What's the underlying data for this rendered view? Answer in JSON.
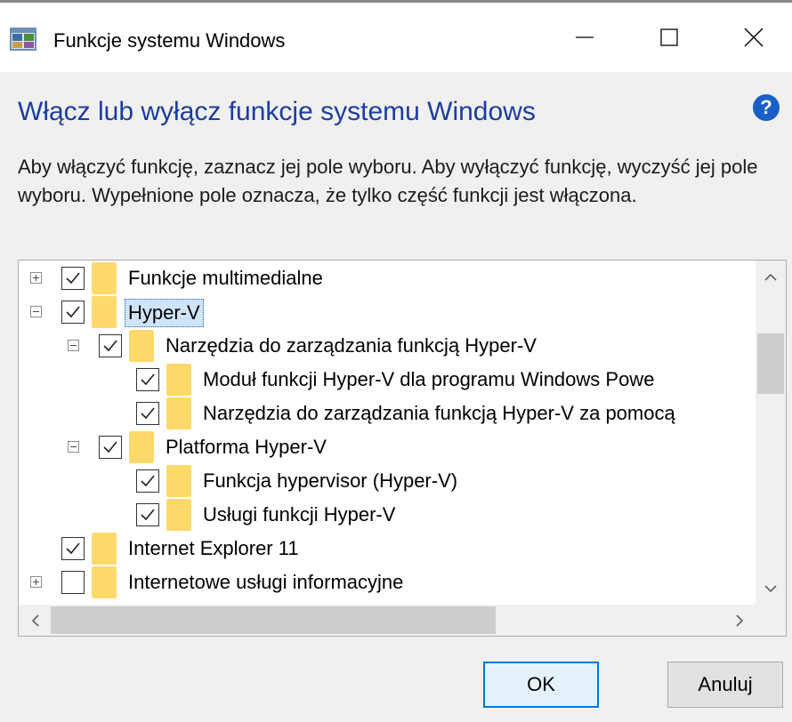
{
  "window": {
    "title": "Funkcje systemu Windows",
    "controls": {
      "minimize": "minimize",
      "maximize": "maximize",
      "close": "close"
    }
  },
  "header": {
    "title": "Włącz lub wyłącz funkcje systemu Windows",
    "help_symbol": "?"
  },
  "description": "Aby włączyć funkcję, zaznacz jej pole wyboru. Aby wyłączyć funkcję, wyczyść jej pole wyboru. Wypełnione pole oznacza, że tylko część funkcji jest włączona.",
  "tree": [
    {
      "label": "Funkcje multimedialne",
      "level": 0,
      "expander": "plus",
      "checked": true,
      "selected": false
    },
    {
      "label": "Hyper-V",
      "level": 0,
      "expander": "minus",
      "checked": true,
      "selected": true
    },
    {
      "label": "Narzędzia do zarządzania funkcją Hyper-V",
      "level": 1,
      "expander": "minus",
      "checked": true,
      "selected": false
    },
    {
      "label": "Moduł funkcji Hyper-V dla programu Windows Powe",
      "level": 2,
      "expander": null,
      "checked": true,
      "selected": false
    },
    {
      "label": "Narzędzia do zarządzania funkcją Hyper-V za pomocą",
      "level": 2,
      "expander": null,
      "checked": true,
      "selected": false
    },
    {
      "label": "Platforma Hyper-V",
      "level": 1,
      "expander": "minus",
      "checked": true,
      "selected": false
    },
    {
      "label": "Funkcja hypervisor (Hyper-V)",
      "level": 2,
      "expander": null,
      "checked": true,
      "selected": false
    },
    {
      "label": "Usługi funkcji Hyper-V",
      "level": 2,
      "expander": null,
      "checked": true,
      "selected": false
    },
    {
      "label": "Internet Explorer 11",
      "level": 0,
      "expander": null,
      "checked": true,
      "selected": false
    },
    {
      "label": "Internetowe usługi informacyjne",
      "level": 0,
      "expander": "plus",
      "checked": false,
      "selected": false
    }
  ],
  "buttons": {
    "ok": "OK",
    "cancel": "Anuluj"
  },
  "colors": {
    "header_blue": "#1b3d9e",
    "folder_yellow": "#ffd96b",
    "selection_bg": "#cfe3fb",
    "accent_blue": "#0078d7",
    "help_icon_blue": "#1a5fc8"
  }
}
